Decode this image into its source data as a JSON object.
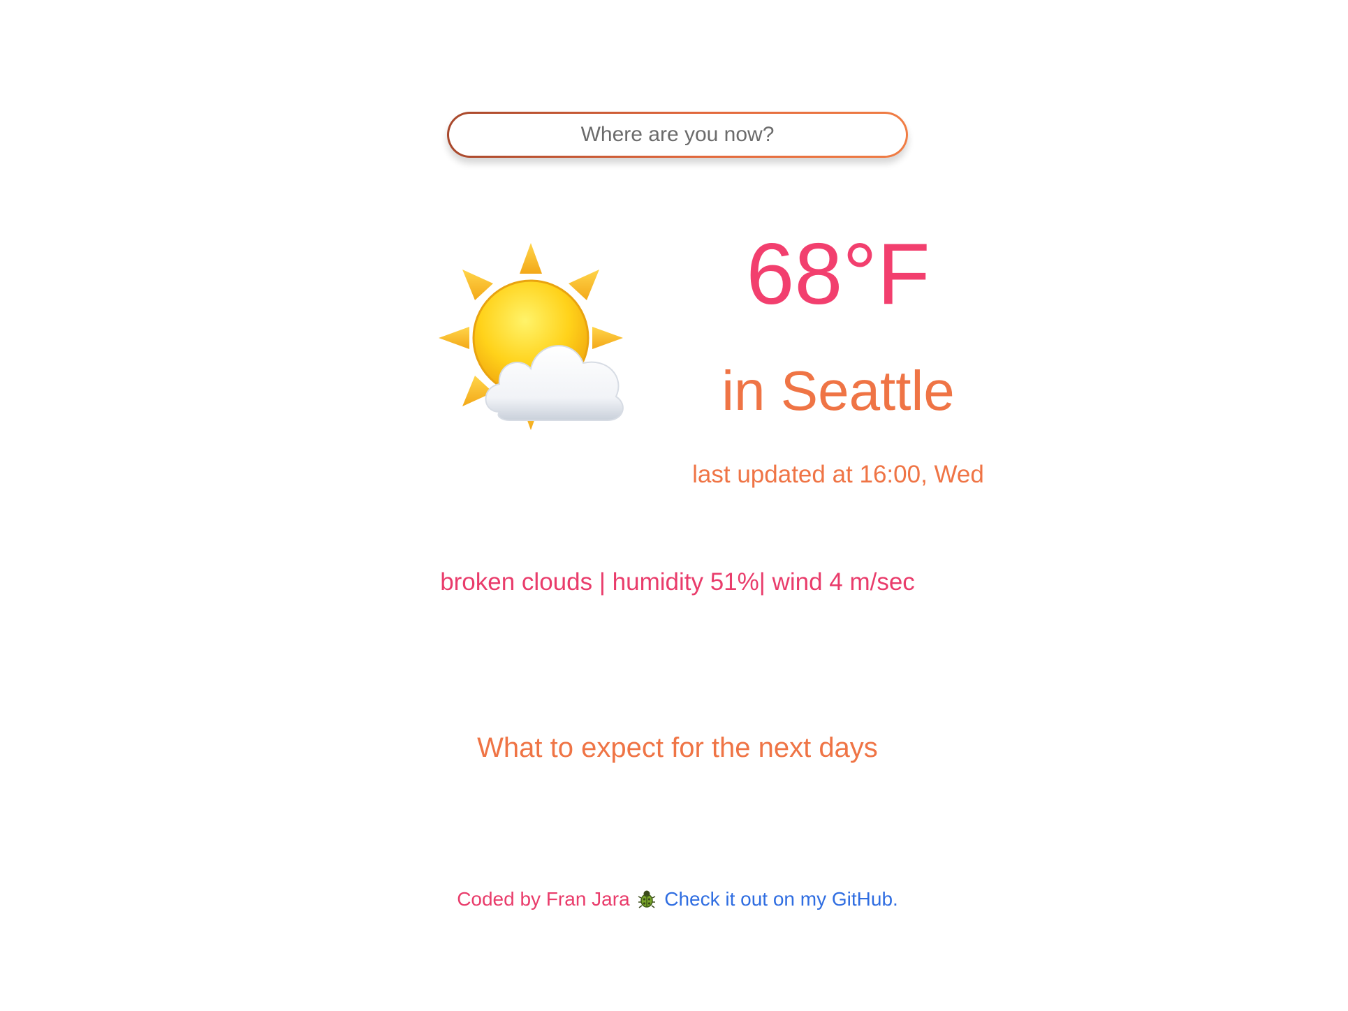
{
  "search": {
    "placeholder": "Where are you now?"
  },
  "current": {
    "icon": "sun-behind-cloud-icon",
    "temperature": "68°F",
    "city": "in Seattle",
    "last_updated": "last updated at 16:00, Wed",
    "details": "broken clouds | humidity 51%| wind 4 m/sec"
  },
  "forecast": {
    "title": "What to expect for the next days"
  },
  "footer": {
    "credit": "Coded by Fran Jara",
    "bug_icon": "bug-icon",
    "link_text": "Check it out on my GitHub."
  },
  "colors": {
    "pink": "#f23f6e",
    "orange": "#ef7445",
    "link": "#2f6de1"
  }
}
